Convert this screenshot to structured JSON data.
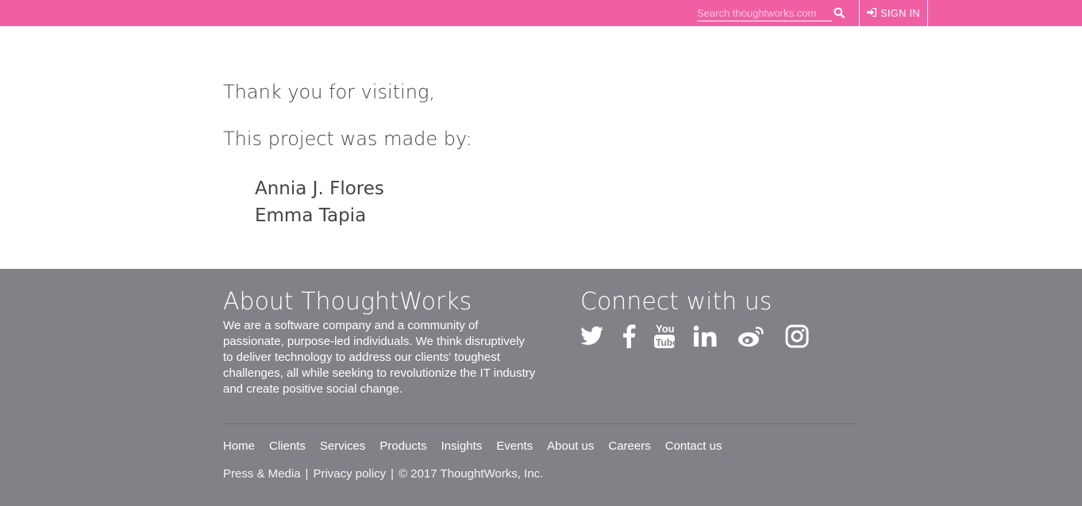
{
  "topbar": {
    "search_placeholder": "Search thoughtworks.com",
    "search_icon": "search-icon",
    "signin_label": "SIGN IN",
    "signin_icon": "sign-in-icon",
    "accent_color": "#f05fa3"
  },
  "main": {
    "line1": "Thank you for visiting,",
    "line2": "This project was made by:",
    "authors": [
      "Annia J. Flores",
      "Emma Tapia"
    ]
  },
  "footer": {
    "about_title": "About ThoughtWorks",
    "about_text": "We are a software company and a community of passionate, purpose-led individuals. We think disruptively to deliver technology to address our clients' toughest challenges, all while seeking to revolutionize the IT industry and create positive social change.",
    "connect_title": "Connect with us",
    "social_icons": [
      "twitter-icon",
      "facebook-icon",
      "youtube-icon",
      "linkedin-icon",
      "weibo-icon",
      "instagram-icon"
    ],
    "nav": [
      "Home",
      "Clients",
      "Services",
      "Products",
      "Insights",
      "Events",
      "About us",
      "Careers",
      "Contact us"
    ],
    "legal": {
      "press": "Press & Media",
      "privacy": "Privacy policy",
      "copyright": "© 2017 ThoughtWorks, Inc.",
      "separator": "|"
    },
    "background_color": "#818287"
  }
}
